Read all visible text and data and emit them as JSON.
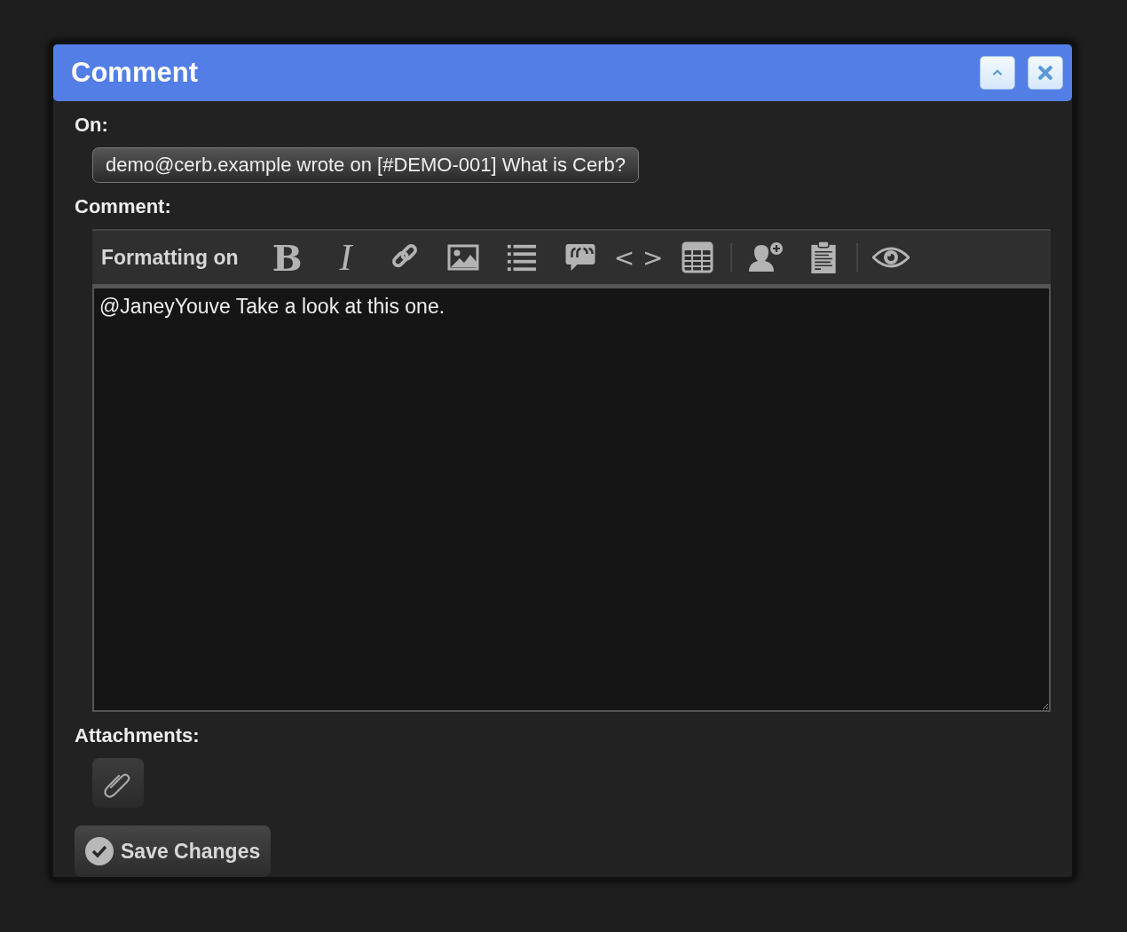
{
  "dialog": {
    "title": "Comment",
    "buttons": [
      {
        "kind": "collapse"
      },
      {
        "kind": "close"
      }
    ]
  },
  "on": {
    "label": "On:",
    "value": "demo@cerb.example wrote on [#DEMO-001] What is Cerb?"
  },
  "comment": {
    "label": "Comment:",
    "formatting_toggle": "Formatting on",
    "tools": [
      {
        "kind": "bold",
        "glyph": "B"
      },
      {
        "kind": "italic",
        "glyph": "I"
      },
      {
        "kind": "link"
      },
      {
        "kind": "image"
      },
      {
        "kind": "list"
      },
      {
        "kind": "quote"
      },
      {
        "kind": "code",
        "glyph": "< >"
      },
      {
        "kind": "table"
      },
      {
        "kind": "separator"
      },
      {
        "kind": "mention"
      },
      {
        "kind": "snippet"
      },
      {
        "kind": "separator"
      },
      {
        "kind": "preview"
      }
    ],
    "value": "@JaneyYouve Take a look at this one."
  },
  "attachments": {
    "label": "Attachments:"
  },
  "save_button": "Save Changes"
}
